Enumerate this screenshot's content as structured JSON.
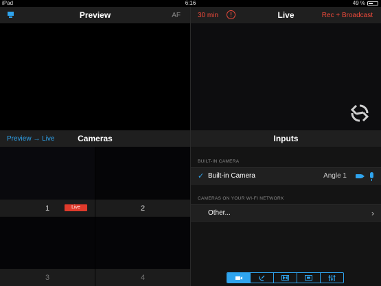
{
  "status": {
    "device": "iPad",
    "time": "6:16",
    "battery": "49 %"
  },
  "preview": {
    "title": "Preview",
    "af_label": "AF"
  },
  "live": {
    "duration": "30 min",
    "warning": "!",
    "title": "Live",
    "action": "Rec + Broadcast"
  },
  "cameras": {
    "header_left": "Preview → Live",
    "title": "Cameras",
    "items": [
      {
        "label": "1",
        "live": "Live"
      },
      {
        "label": "2"
      },
      {
        "label": "3"
      },
      {
        "label": "4"
      }
    ]
  },
  "inputs": {
    "title": "Inputs",
    "section_builtin": "BUILT-IN CAMERA",
    "builtin": {
      "name": "Built-in Camera",
      "angle": "Angle 1"
    },
    "section_wifi": "CAMERAS ON YOUR WI-FI NETWORK",
    "other": "Other..."
  },
  "toolbar": {
    "items": [
      "camera",
      "satellite",
      "transition",
      "overlay",
      "mixer"
    ],
    "active": 0
  },
  "colors": {
    "accent": "#2fa4ee",
    "alert": "#ef4a3b"
  }
}
